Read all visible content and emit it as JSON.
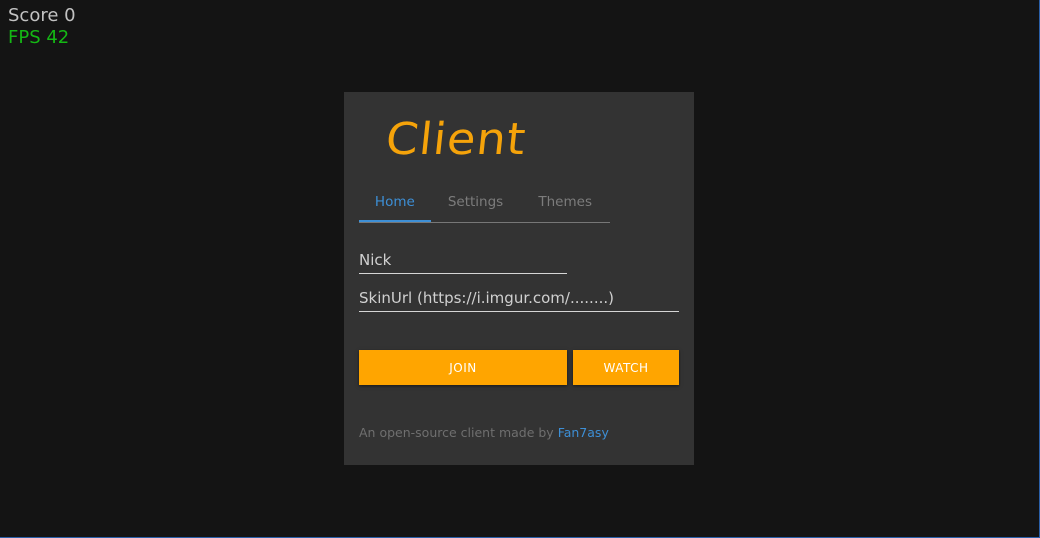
{
  "hud": {
    "score": "Score 0",
    "fps": "FPS 42"
  },
  "menu": {
    "logo": "Client",
    "tabs": [
      {
        "label": "Home",
        "active": true
      },
      {
        "label": "Settings",
        "active": false
      },
      {
        "label": "Themes",
        "active": false
      }
    ],
    "nick": {
      "value": "",
      "placeholder": "Nick"
    },
    "skin": {
      "value": "",
      "placeholder": "SkinUrl (https://i.imgur.com/........)"
    },
    "join_label": "JOIN",
    "watch_label": "WATCH",
    "footer_text": "An open-source client made by ",
    "footer_author": "Fan7asy"
  },
  "colors": {
    "accent": "#ffa500",
    "link": "#3d8fd6",
    "panel_bg": "#333333",
    "page_bg": "#141414",
    "fps": "#14b814"
  }
}
